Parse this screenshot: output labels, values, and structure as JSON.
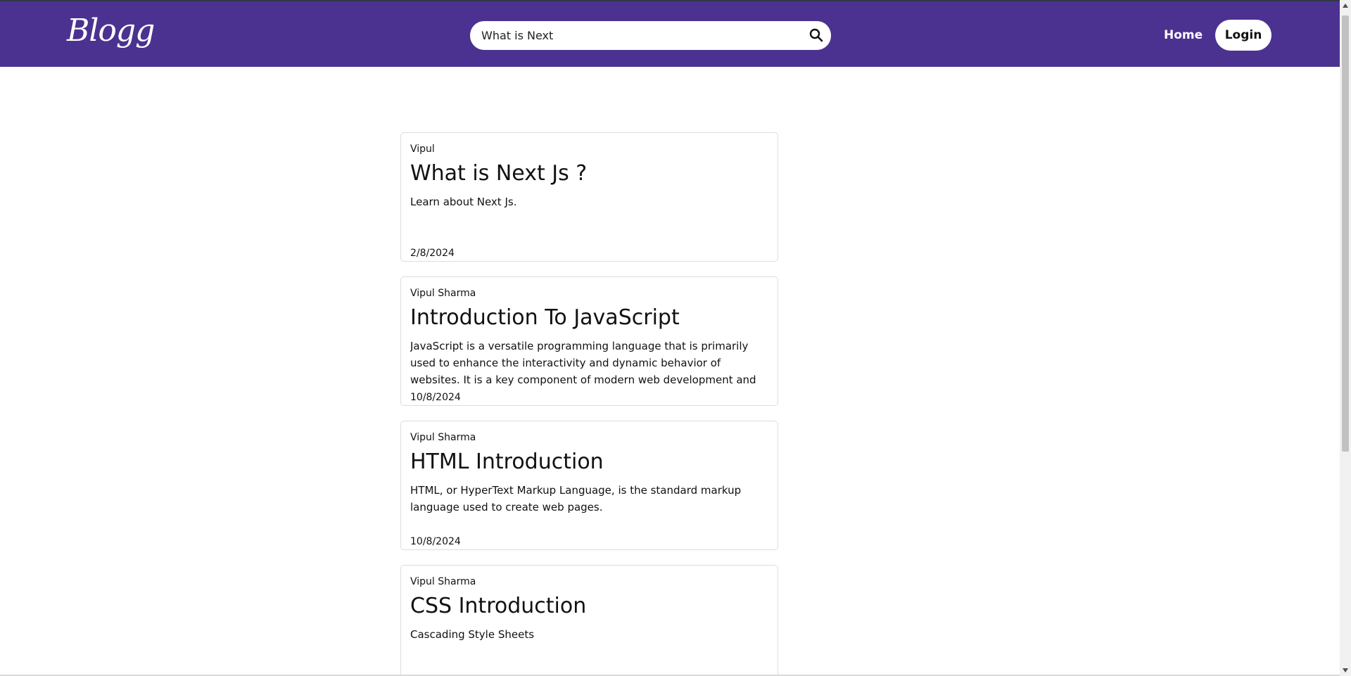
{
  "header": {
    "logo": "Blogg",
    "search_value": "What is Next",
    "nav": {
      "home_label": "Home",
      "login_label": "Login"
    }
  },
  "posts": [
    {
      "author": "Vipul",
      "title": "What is Next Js ?",
      "description": "Learn about Next Js.",
      "date": "2/8/2024"
    },
    {
      "author": "Vipul Sharma",
      "title": "Introduction To JavaScript",
      "description": "JavaScript is a versatile programming language that is primarily used to enhance the interactivity and dynamic behavior of websites. It is a key component of modern web development and plays a vital",
      "date": "10/8/2024"
    },
    {
      "author": "Vipul Sharma",
      "title": "HTML Introduction",
      "description": "HTML, or HyperText Markup Language, is the standard markup language used to create web pages.",
      "date": "10/8/2024"
    },
    {
      "author": "Vipul Sharma",
      "title": "CSS Introduction",
      "description": "Cascading Style Sheets",
      "date": ""
    }
  ],
  "colors": {
    "header_bg": "#4b3290",
    "card_border": "#dddddd"
  },
  "icons": {
    "search": "search-icon",
    "scroll_up": "arrow-up-icon",
    "scroll_down": "arrow-down-icon"
  }
}
